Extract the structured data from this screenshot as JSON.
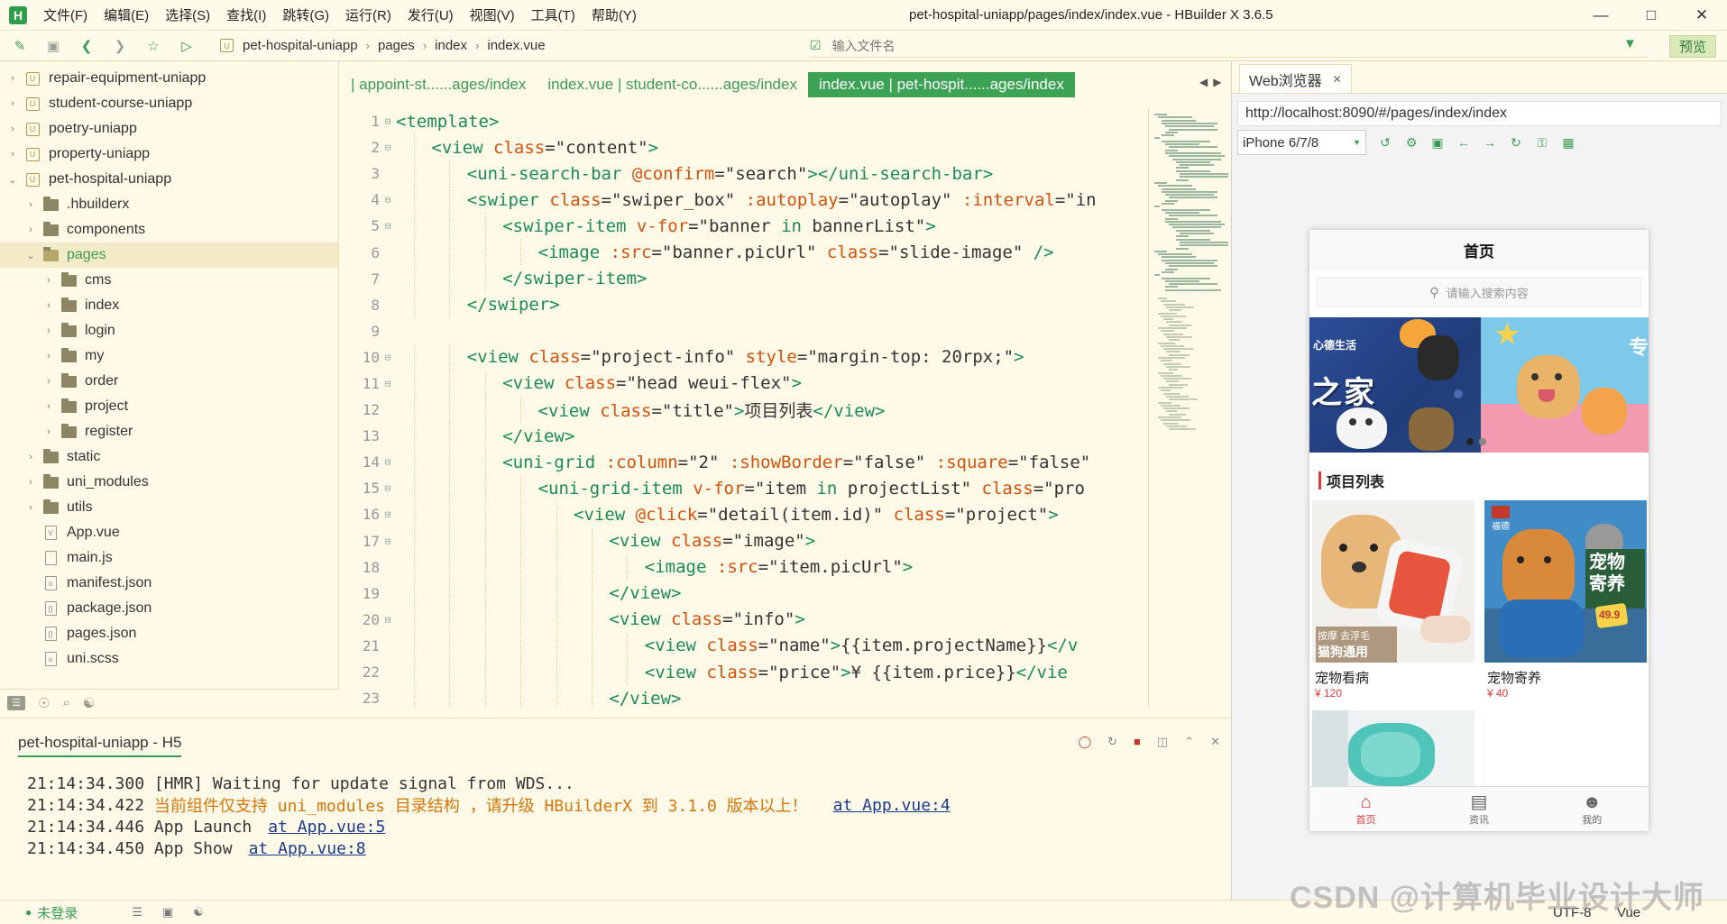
{
  "app": {
    "logo_letter": "H",
    "window_title": "pet-hospital-uniapp/pages/index/index.vue - HBuilder X 3.6.5",
    "menus": [
      "文件(F)",
      "编辑(E)",
      "选择(S)",
      "查找(I)",
      "跳转(G)",
      "运行(R)",
      "发行(U)",
      "视图(V)",
      "工具(T)",
      "帮助(Y)"
    ],
    "window_controls": [
      "minimize-icon",
      "maximize-icon",
      "close-icon"
    ],
    "accent_color": "#3ca354"
  },
  "toolbar": {
    "breadcrumb": [
      "pet-hospital-uniapp",
      "pages",
      "index",
      "index.vue"
    ],
    "file_search_placeholder": "输入文件名",
    "preview_label": "预览",
    "icons": [
      "new-file-icon",
      "save-icon",
      "back-icon",
      "forward-icon",
      "star-icon",
      "run-icon"
    ]
  },
  "project_tree": {
    "items": [
      {
        "label": "repair-equipment-uniapp",
        "type": "project",
        "depth": 0,
        "expanded": false
      },
      {
        "label": "student-course-uniapp",
        "type": "project",
        "depth": 0,
        "expanded": false
      },
      {
        "label": "poetry-uniapp",
        "type": "project",
        "depth": 0,
        "expanded": false
      },
      {
        "label": "property-uniapp",
        "type": "project",
        "depth": 0,
        "expanded": false
      },
      {
        "label": "pet-hospital-uniapp",
        "type": "project",
        "depth": 0,
        "expanded": true
      },
      {
        "label": ".hbuilderx",
        "type": "folder",
        "depth": 1,
        "expanded": false
      },
      {
        "label": "components",
        "type": "folder",
        "depth": 1,
        "expanded": false
      },
      {
        "label": "pages",
        "type": "folder",
        "depth": 1,
        "expanded": true,
        "selected": true
      },
      {
        "label": "cms",
        "type": "folder",
        "depth": 2,
        "expanded": false
      },
      {
        "label": "index",
        "type": "folder",
        "depth": 2,
        "expanded": false
      },
      {
        "label": "login",
        "type": "folder",
        "depth": 2,
        "expanded": false
      },
      {
        "label": "my",
        "type": "folder",
        "depth": 2,
        "expanded": false
      },
      {
        "label": "order",
        "type": "folder",
        "depth": 2,
        "expanded": false
      },
      {
        "label": "project",
        "type": "folder",
        "depth": 2,
        "expanded": false
      },
      {
        "label": "register",
        "type": "folder",
        "depth": 2,
        "expanded": false
      },
      {
        "label": "static",
        "type": "folder",
        "depth": 1,
        "expanded": false
      },
      {
        "label": "uni_modules",
        "type": "folder",
        "depth": 1,
        "expanded": false
      },
      {
        "label": "utils",
        "type": "folder",
        "depth": 1,
        "expanded": false
      },
      {
        "label": "App.vue",
        "type": "file",
        "depth": 1,
        "badge": "V"
      },
      {
        "label": "main.js",
        "type": "file",
        "depth": 1,
        "badge": ""
      },
      {
        "label": "manifest.json",
        "type": "file",
        "depth": 1,
        "badge": "o"
      },
      {
        "label": "package.json",
        "type": "file",
        "depth": 1,
        "badge": "[]"
      },
      {
        "label": "pages.json",
        "type": "file",
        "depth": 1,
        "badge": "[]"
      },
      {
        "label": "uni.scss",
        "type": "file",
        "depth": 1,
        "badge": "s"
      }
    ]
  },
  "editor_tabs": [
    {
      "label": "| appoint-st......ages/index",
      "active": false
    },
    {
      "label": "index.vue | student-co......ages/index",
      "active": false
    },
    {
      "label": "index.vue | pet-hospit......ages/index",
      "active": true
    }
  ],
  "code_lines": [
    {
      "n": "1",
      "fold": true,
      "indent": 0,
      "segs": [
        [
          "tg",
          "<template>"
        ]
      ]
    },
    {
      "n": "2",
      "fold": true,
      "indent": 1,
      "segs": [
        [
          "tg",
          "<view "
        ],
        [
          "at",
          "class"
        ],
        [
          "st",
          "=\"content\""
        ],
        [
          "tg",
          ">"
        ]
      ]
    },
    {
      "n": "3",
      "fold": false,
      "indent": 2,
      "segs": [
        [
          "tg",
          "<uni-search-bar "
        ],
        [
          "at",
          "@confirm"
        ],
        [
          "st",
          "=\"search\""
        ],
        [
          "tg",
          "></uni-search-bar>"
        ]
      ]
    },
    {
      "n": "4",
      "fold": true,
      "indent": 2,
      "segs": [
        [
          "tg",
          "<swiper "
        ],
        [
          "at",
          "class"
        ],
        [
          "st",
          "=\"swiper_box\" "
        ],
        [
          "at",
          ":autoplay"
        ],
        [
          "st",
          "=\"autoplay\" "
        ],
        [
          "at",
          ":interval"
        ],
        [
          "st",
          "=\"in"
        ]
      ]
    },
    {
      "n": "5",
      "fold": true,
      "indent": 3,
      "segs": [
        [
          "tg",
          "<swiper-item "
        ],
        [
          "at",
          "v-for"
        ],
        [
          "st",
          "=\"banner "
        ],
        [
          "kw",
          "in"
        ],
        [
          "st",
          " bannerList\""
        ],
        [
          "tg",
          ">"
        ]
      ]
    },
    {
      "n": "6",
      "fold": false,
      "indent": 4,
      "segs": [
        [
          "tg",
          "<image "
        ],
        [
          "at",
          ":src"
        ],
        [
          "st",
          "=\"banner.picUrl\" "
        ],
        [
          "at",
          "class"
        ],
        [
          "st",
          "=\"slide-image\" "
        ],
        [
          "tg",
          "/>"
        ]
      ]
    },
    {
      "n": "7",
      "fold": false,
      "indent": 3,
      "segs": [
        [
          "tg",
          "</swiper-item>"
        ]
      ]
    },
    {
      "n": "8",
      "fold": false,
      "indent": 2,
      "segs": [
        [
          "tg",
          "</swiper>"
        ]
      ]
    },
    {
      "n": "9",
      "fold": false,
      "indent": 0,
      "segs": []
    },
    {
      "n": "10",
      "fold": true,
      "indent": 2,
      "segs": [
        [
          "tg",
          "<view "
        ],
        [
          "at",
          "class"
        ],
        [
          "st",
          "=\"project-info\" "
        ],
        [
          "at",
          "style"
        ],
        [
          "st",
          "=\"margin-top: 20rpx;\""
        ],
        [
          "tg",
          ">"
        ]
      ]
    },
    {
      "n": "11",
      "fold": true,
      "indent": 3,
      "segs": [
        [
          "tg",
          "<view "
        ],
        [
          "at",
          "class"
        ],
        [
          "st",
          "=\"head weui-flex\""
        ],
        [
          "tg",
          ">"
        ]
      ]
    },
    {
      "n": "12",
      "fold": false,
      "indent": 4,
      "segs": [
        [
          "tg",
          "<view "
        ],
        [
          "at",
          "class"
        ],
        [
          "st",
          "=\"title\""
        ],
        [
          "tg",
          ">"
        ],
        [
          "plain",
          "项目列表"
        ],
        [
          "tg",
          "</view>"
        ]
      ]
    },
    {
      "n": "13",
      "fold": false,
      "indent": 3,
      "segs": [
        [
          "tg",
          "</view>"
        ]
      ]
    },
    {
      "n": "14",
      "fold": true,
      "indent": 3,
      "segs": [
        [
          "tg",
          "<uni-grid "
        ],
        [
          "at",
          ":column"
        ],
        [
          "st",
          "=\"2\" "
        ],
        [
          "at",
          ":showBorder"
        ],
        [
          "st",
          "=\"false\" "
        ],
        [
          "at",
          ":square"
        ],
        [
          "st",
          "=\"false\""
        ]
      ]
    },
    {
      "n": "15",
      "fold": true,
      "indent": 4,
      "segs": [
        [
          "tg",
          "<uni-grid-item "
        ],
        [
          "at",
          "v-for"
        ],
        [
          "st",
          "=\"item "
        ],
        [
          "kw",
          "in"
        ],
        [
          "st",
          " projectList\" "
        ],
        [
          "at",
          "class"
        ],
        [
          "st",
          "=\"pro"
        ]
      ]
    },
    {
      "n": "16",
      "fold": true,
      "indent": 5,
      "segs": [
        [
          "tg",
          "<view "
        ],
        [
          "at",
          "@click"
        ],
        [
          "st",
          "=\"detail(item.id)\" "
        ],
        [
          "at",
          "class"
        ],
        [
          "st",
          "=\"project\""
        ],
        [
          "tg",
          ">"
        ]
      ]
    },
    {
      "n": "17",
      "fold": true,
      "indent": 6,
      "segs": [
        [
          "tg",
          "<view "
        ],
        [
          "at",
          "class"
        ],
        [
          "st",
          "=\"image\""
        ],
        [
          "tg",
          ">"
        ]
      ]
    },
    {
      "n": "18",
      "fold": false,
      "indent": 7,
      "segs": [
        [
          "tg",
          "<image "
        ],
        [
          "at",
          ":src"
        ],
        [
          "st",
          "=\"item.picUrl\""
        ],
        [
          "tg",
          ">"
        ]
      ]
    },
    {
      "n": "19",
      "fold": false,
      "indent": 6,
      "segs": [
        [
          "tg",
          "</view>"
        ]
      ]
    },
    {
      "n": "20",
      "fold": true,
      "indent": 6,
      "segs": [
        [
          "tg",
          "<view "
        ],
        [
          "at",
          "class"
        ],
        [
          "st",
          "=\"info\""
        ],
        [
          "tg",
          ">"
        ]
      ]
    },
    {
      "n": "21",
      "fold": false,
      "indent": 7,
      "segs": [
        [
          "tg",
          "<view "
        ],
        [
          "at",
          "class"
        ],
        [
          "st",
          "=\"name\""
        ],
        [
          "tg",
          ">"
        ],
        [
          "plain",
          "{{item.projectName}}"
        ],
        [
          "tg",
          "</v"
        ]
      ]
    },
    {
      "n": "22",
      "fold": false,
      "indent": 7,
      "segs": [
        [
          "tg",
          "<view "
        ],
        [
          "at",
          "class"
        ],
        [
          "st",
          "=\"price\""
        ],
        [
          "tg",
          ">"
        ],
        [
          "plain",
          "¥ {{item.price}}"
        ],
        [
          "tg",
          "</vie"
        ]
      ]
    },
    {
      "n": "23",
      "fold": false,
      "indent": 6,
      "segs": [
        [
          "tg",
          "</view>"
        ]
      ]
    }
  ],
  "browser": {
    "tab_label": "Web浏览器",
    "url": "http://localhost:8090/#/pages/index/index",
    "device": "iPhone 6/7/8",
    "tool_icons": [
      "rotate-icon",
      "settings-icon",
      "screenshot-icon",
      "back-icon",
      "forward-icon",
      "refresh-icon",
      "lock-icon",
      "qrcode-icon"
    ]
  },
  "phone": {
    "nav_title": "首页",
    "search_placeholder": "请输入搜索内容",
    "section_title": "项目列表",
    "banner_texts": [
      "心德生活",
      "之家",
      "专"
    ],
    "projects": [
      {
        "name": "宠物看病",
        "price": "¥ 120",
        "img_text": "按摩 去浮毛",
        "img_text2": "猫狗通用"
      },
      {
        "name": "宠物寄养",
        "price": "¥ 40",
        "img_text": "宠物",
        "img_text2": "寄养",
        "img_text3": "49.9",
        "img_text4": "福德"
      },
      {
        "name": "",
        "price": "",
        "img_text": "",
        "img_text2": ""
      }
    ],
    "tabbar": [
      {
        "label": "首页",
        "icon": "home-icon",
        "active": true
      },
      {
        "label": "资讯",
        "icon": "news-icon",
        "active": false
      },
      {
        "label": "我的",
        "icon": "user-icon",
        "active": false
      }
    ],
    "highlight_color": "#e23b3b"
  },
  "console": {
    "tab_label": "pet-hospital-uniapp - H5",
    "lines": [
      {
        "time": "21:14:34.300",
        "text": "[HMR] Waiting for update signal from WDS...",
        "warn": false,
        "link": ""
      },
      {
        "time": "21:14:34.422",
        "text": "当前组件仅支持 uni_modules 目录结构 ，请升级 HBuilderX 到 3.1.0 版本以上！",
        "warn": true,
        "link": "at App.vue:4"
      },
      {
        "time": "21:14:34.446",
        "text": "App Launch",
        "warn": false,
        "link": "at App.vue:5"
      },
      {
        "time": "21:14:34.450",
        "text": "App Show",
        "warn": false,
        "link": "at App.vue:8"
      }
    ]
  },
  "statusbar": {
    "login": "未登录",
    "encoding": "UTF-8",
    "language": "Vue",
    "watermark": "CSDN @计算机毕业设计大师"
  }
}
